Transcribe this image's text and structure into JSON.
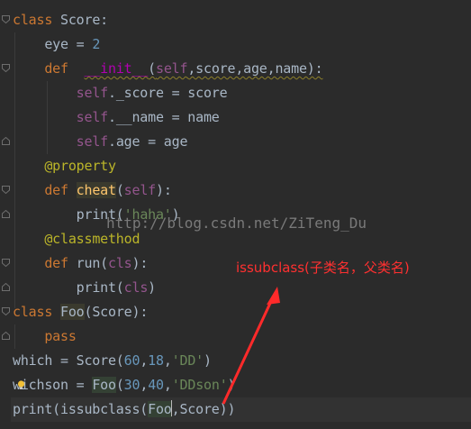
{
  "editor": {
    "lines": [
      {
        "tokens": [
          [
            "kw",
            "class"
          ],
          [
            "",
            "Score:"
          ]
        ]
      },
      {
        "tokens": [
          [
            "",
            "    eye = "
          ],
          [
            "num",
            "2"
          ]
        ]
      },
      {
        "tokens": [
          [
            "",
            "    "
          ],
          [
            "kw",
            "def"
          ],
          [
            "",
            "  "
          ],
          [
            "dunder",
            "__init__"
          ],
          [
            "",
            "("
          ],
          [
            "self",
            "self"
          ],
          [
            "",
            ",score,age,name):"
          ]
        ]
      },
      {
        "tokens": [
          [
            "",
            "        "
          ],
          [
            "self",
            "self"
          ],
          [
            "",
            "._score = score"
          ]
        ]
      },
      {
        "tokens": [
          [
            "",
            "        "
          ],
          [
            "self",
            "self"
          ],
          [
            "",
            "._name = name"
          ]
        ]
      },
      {
        "tokens": [
          [
            "",
            "        "
          ],
          [
            "self",
            "self"
          ],
          [
            "",
            ".age = age"
          ]
        ]
      },
      {
        "tokens": [
          [
            "",
            "    "
          ],
          [
            "deco",
            "@property"
          ]
        ]
      },
      {
        "tokens": [
          [
            "",
            "    "
          ],
          [
            "kw",
            "def"
          ],
          [
            "",
            ""
          ],
          [
            "fn",
            "cheat"
          ],
          [
            "",
            "("
          ],
          [
            "self",
            "self"
          ],
          [
            "",
            "):"
          ]
        ]
      },
      {
        "tokens": [
          [
            "",
            "        print("
          ],
          [
            "str",
            "'haha'"
          ],
          [
            "",
            ")"
          ]
        ]
      },
      {
        "tokens": [
          [
            "",
            "    "
          ],
          [
            "deco",
            "@classmethod"
          ]
        ]
      },
      {
        "tokens": [
          [
            "",
            "    "
          ],
          [
            "kw",
            "def"
          ],
          [
            "",
            ""
          ],
          [
            "fn",
            "run"
          ],
          [
            "",
            "("
          ],
          [
            "self",
            "cls"
          ],
          [
            "",
            "):"
          ]
        ]
      },
      {
        "tokens": [
          [
            "",
            "        print("
          ],
          [
            "self",
            "cls"
          ],
          [
            "",
            ")"
          ]
        ]
      },
      {
        "tokens": [
          [
            "kw",
            "class"
          ],
          [
            "",
            "Foo(Score):"
          ]
        ]
      },
      {
        "tokens": [
          [
            "",
            "    "
          ],
          [
            "kw",
            "pass"
          ]
        ]
      },
      {
        "tokens": [
          [
            "",
            "which = Score("
          ],
          [
            "num",
            "60"
          ],
          [
            "",
            ","
          ],
          [
            "num",
            "18"
          ],
          [
            "",
            ","
          ],
          [
            "str",
            "'DD'"
          ],
          [
            "",
            ")"
          ]
        ]
      },
      {
        "tokens": [
          [
            "",
            "whichson = Foo("
          ],
          [
            "num",
            "30"
          ],
          [
            "",
            ","
          ],
          [
            "num",
            "40"
          ],
          [
            "",
            ","
          ],
          [
            "str",
            "'DDson'"
          ],
          [
            "",
            ")"
          ]
        ]
      },
      {
        "tokens": [
          [
            "",
            "print(issubclass(Foo,Score))"
          ]
        ]
      }
    ]
  },
  "code": {
    "l1_kw": "class",
    "l1_name": "Score",
    "l1_colon": ":",
    "l2_pre": "eye = ",
    "l2_num": "2",
    "l3_def": "def",
    "l3_init": "__init__",
    "l3_open": "(",
    "l3_self": "self",
    "l3_rest": ",score,age,name):",
    "l4_self": "self",
    "l4_rest": "._score = score",
    "l5_self": "self",
    "l5_rest": ".__name = name",
    "l6_self": "self",
    "l6_rest": ".age = age",
    "l7_deco": "@property",
    "l8_def": "def",
    "l8_fn": "cheat",
    "l8_open": "(",
    "l8_self": "self",
    "l8_close": "):",
    "l9_print": "print(",
    "l9_str": "'haha'",
    "l9_close": ")",
    "l10_deco": "@classmethod",
    "l11_def": "def",
    "l11_fn": "run",
    "l11_open": "(",
    "l11_cls": "cls",
    "l11_close": "):",
    "l12_print": "print(",
    "l12_cls": "cls",
    "l12_close": ")",
    "l13_kw": "class",
    "l13_name": "Foo",
    "l13_open": "(",
    "l13_base": "Score",
    "l13_close": "):",
    "l14_kw": "pass",
    "l15_pre": "which = Score(",
    "l15_a": "60",
    "l15_c1": ",",
    "l15_b": "18",
    "l15_c2": ",",
    "l15_s": "'DD'",
    "l15_close": ")",
    "l16_w": "w",
    "l16_rest1": "ichson = ",
    "l16_foo": "Foo",
    "l16_open": "(",
    "l16_a": "30",
    "l16_c1": ",",
    "l16_b": "40",
    "l16_c2": ",",
    "l16_s": "'DDson'",
    "l16_close": ")",
    "l17_pre": "print(issubclass(",
    "l17_foo": "Foo",
    "l17_comma": ",",
    "l17_score": "Score",
    "l17_close": "))"
  },
  "watermark": "http://blog.csdn.net/ZiTeng_Du",
  "annotation": "issubclass(子类名，父类名)",
  "colors": {
    "background": "#2b2b2b",
    "keyword": "#cc7832",
    "self": "#94558d",
    "number": "#6897bb",
    "string": "#6a8759",
    "decorator": "#bbb529",
    "function": "#ffc66d",
    "annotation": "#ff3030"
  },
  "icons": {
    "fold_marker": "fold-icon",
    "intention_bulb": "lightbulb-icon"
  }
}
